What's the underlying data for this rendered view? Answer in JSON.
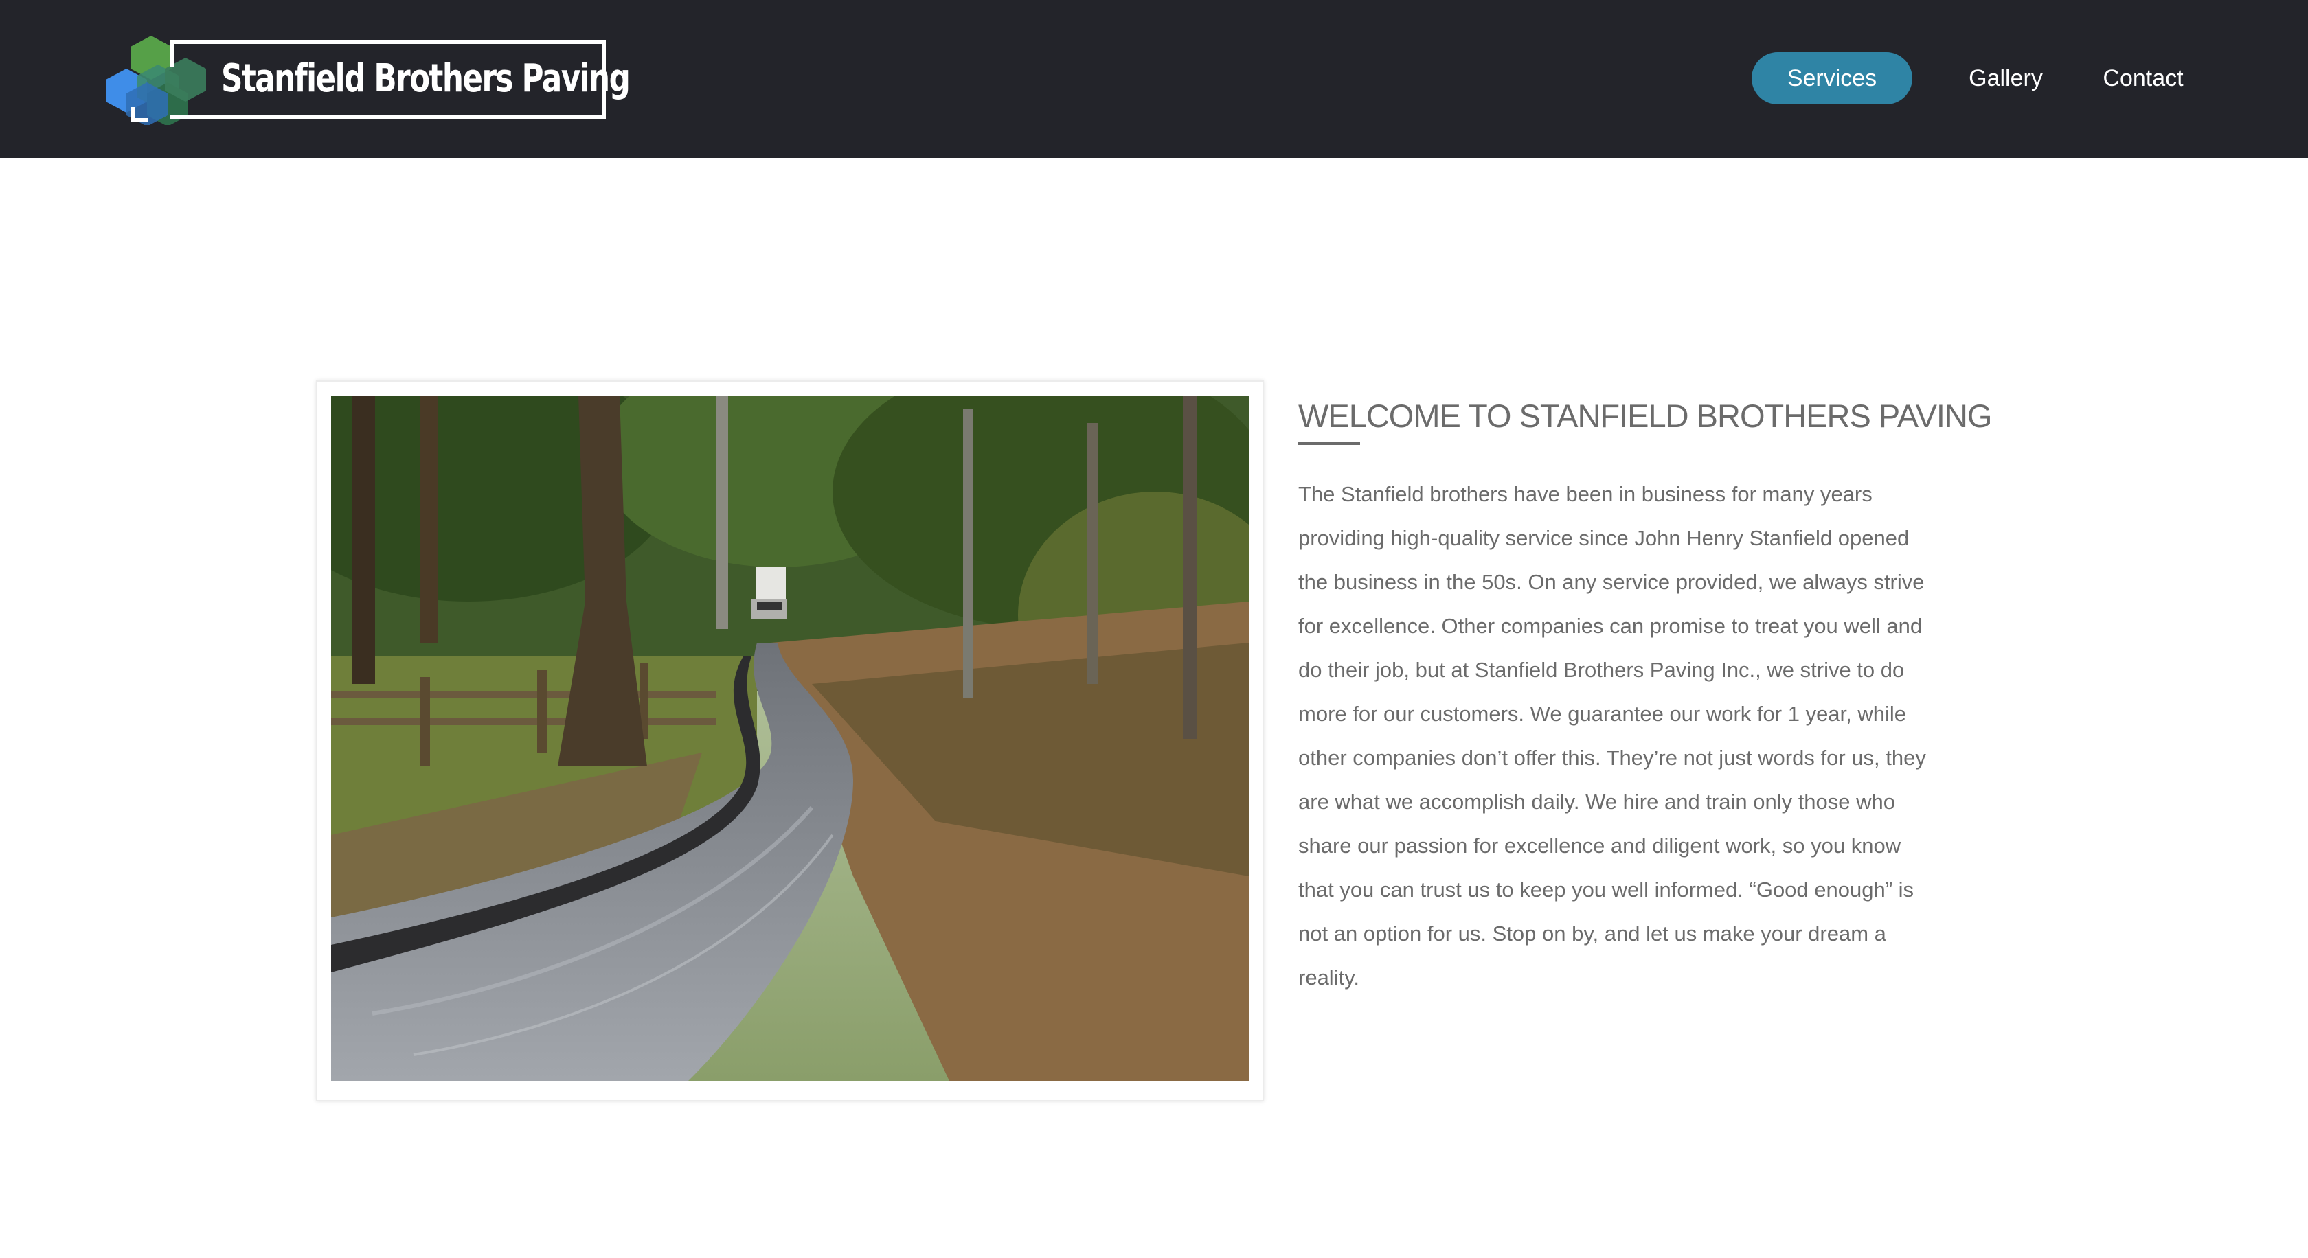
{
  "header": {
    "logo_text": "Stanfield Brothers Paving",
    "nav": {
      "services": "Services",
      "gallery": "Gallery",
      "contact": "Contact"
    }
  },
  "colors": {
    "header_bg": "#23242a",
    "accent": "#2f84a5",
    "text": "#6b6b6b"
  },
  "main": {
    "photo_alt": "Freshly paved winding driveway through a wooded area with a truck in the distance",
    "heading": "WELCOME TO STANFIELD BROTHERS PAVING",
    "paragraph": "The Stanfield brothers have been in business for many years providing high-quality service since John Henry Stanfield opened the business in the 50s. On any service provided, we always strive for excellence. Other companies can promise to treat you well and do their job, but at Stanfield Brothers Paving Inc., we strive to do more for our customers. We guarantee our work for 1 year, while other companies don’t offer this. They’re not just words for us, they are what we accomplish daily. We hire and train only those who share our passion for excellence and diligent work, so you know that you can trust us to keep you well informed. “Good enough” is not an option for us. Stop on by, and let us make your dream a reality."
  }
}
